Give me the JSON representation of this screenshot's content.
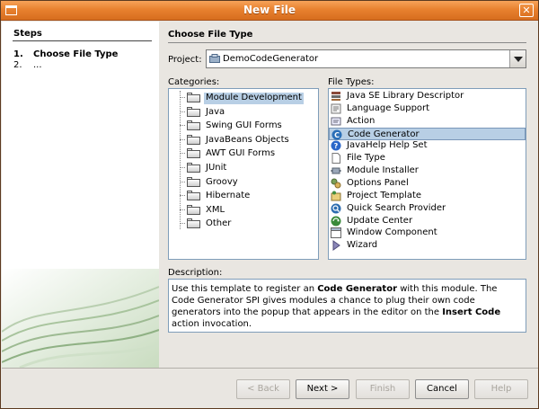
{
  "window": {
    "title": "New File"
  },
  "steps": {
    "title": "Steps",
    "items": [
      {
        "num": "1.",
        "label": "Choose File Type"
      },
      {
        "num": "2.",
        "label": "..."
      }
    ]
  },
  "main": {
    "section_title": "Choose File Type",
    "project_label": "Project:",
    "project_value": "DemoCodeGenerator",
    "categories_label": "Categories:",
    "file_types_label": "File Types:",
    "description_label": "Description:",
    "categories": [
      "Module Development",
      "Java",
      "Swing GUI Forms",
      "JavaBeans Objects",
      "AWT GUI Forms",
      "JUnit",
      "Groovy",
      "Hibernate",
      "XML",
      "Other"
    ],
    "selected_category": "Module Development",
    "file_types": [
      {
        "label": "Java SE Library Descriptor",
        "icon": "library-icon"
      },
      {
        "label": "Language Support",
        "icon": "language-icon"
      },
      {
        "label": "Action",
        "icon": "action-icon"
      },
      {
        "label": "Code Generator",
        "icon": "code-generator-icon"
      },
      {
        "label": "JavaHelp Help Set",
        "icon": "help-icon"
      },
      {
        "label": "File Type",
        "icon": "file-icon"
      },
      {
        "label": "Module Installer",
        "icon": "module-icon"
      },
      {
        "label": "Options Panel",
        "icon": "options-icon"
      },
      {
        "label": "Project Template",
        "icon": "template-icon"
      },
      {
        "label": "Quick Search Provider",
        "icon": "search-icon"
      },
      {
        "label": "Update Center",
        "icon": "update-icon"
      },
      {
        "label": "Window Component",
        "icon": "window-icon"
      },
      {
        "label": "Wizard",
        "icon": "wizard-icon"
      }
    ],
    "selected_file_type": "Code Generator",
    "description": {
      "t1": "Use this template to register an ",
      "b1": "Code Generator",
      "t2": " with this module. The Code Generator SPI gives modules a chance to plug their own code generators into the popup that appears in the editor on the ",
      "b2": "Insert Code",
      "t3": " action invocation."
    }
  },
  "buttons": {
    "back": "< Back",
    "next": "Next >",
    "finish": "Finish",
    "cancel": "Cancel",
    "help": "Help"
  },
  "colors": {
    "title_bar": "#e8812f",
    "selection": "#b8cfe5"
  }
}
